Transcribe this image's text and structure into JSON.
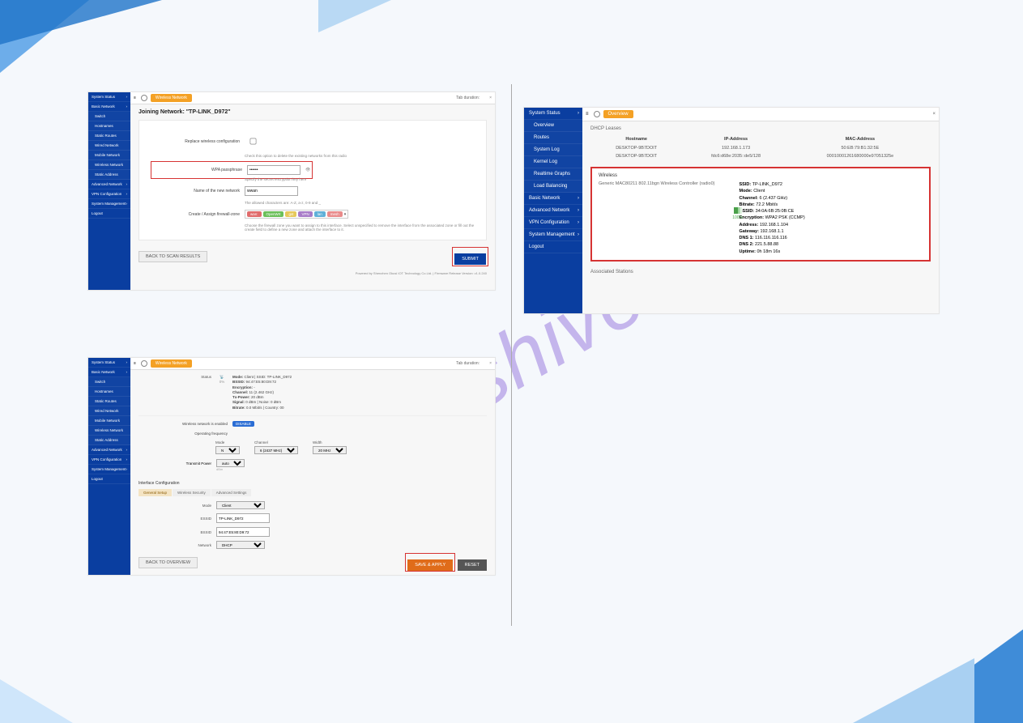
{
  "watermark": "manualshive.com",
  "sidebar": {
    "system_status": "System Status",
    "overview": "Overview",
    "routes": "Routes",
    "system_log": "System Log",
    "kernel_log": "Kernel Log",
    "realtime_graphs": "Realtime Graphs",
    "load_balancing": "Load Balancing",
    "basic_network": "Basic Network",
    "switch": "Switch",
    "hostnames": "Hostnames",
    "static_routes": "Static Routes",
    "wired_network": "Wired Network",
    "mobile_network": "Mobile Network",
    "wireless_network": "Wireless Network",
    "static_address": "Static Address",
    "advanced_network": "Advanced Network",
    "vpn_config": "VPN Configuration",
    "system_management": "System Management",
    "logout": "Logout"
  },
  "tabbar": {
    "active_tab": "Wireless Network",
    "active_tab_overview": "Overview",
    "right_label": "Tab duration:"
  },
  "shot1": {
    "heading": "Joining Network: \"TP-LINK_D972\"",
    "replace_label": "Replace wireless configuration",
    "replace_tip": "Check this option to delete the existing networks from this radio",
    "wpa_label": "WPA passphrase",
    "wpa_tip": "Specify the secret encryption key here",
    "name_label": "Name of the new network",
    "name_value": "wwan",
    "name_tip": "The allowed characters are: A-Z, a-z, 0-9 and _",
    "fw_label": "Create / Assign firewall-zone",
    "fw_tags": {
      "wan": "wan:",
      "OpenWrt": "OpenWrt",
      "gst": "gst",
      "vpn": "VPN",
      "lan": "lan",
      "mesh": "mesh"
    },
    "fw_tip": "Choose the firewall zone you want to assign to this interface. Select unspecified to remove the interface from the associated zone or fill out the create field to define a new zone and attach the interface to it.",
    "back_btn": "BACK TO SCAN RESULTS",
    "submit_btn": "SUBMIT",
    "footnote": "Powered by Shenzhen Okusi IOT Technology Co.Ltd. | Firmware Release Version: v1.0.240"
  },
  "shot2": {
    "status_label": "Status",
    "mode": "Mode: ",
    "mode_val": "Client | SSID: TP-LINK_D972",
    "bssid": "BSSID: ",
    "bssid_val": "94:47:E5:80:D9:72",
    "enc": "Encryption: ",
    "enc_val": "-",
    "channel": "Channel: ",
    "channel_val": "11 (2.462 GHz)",
    "txpower": "Tx-Power: ",
    "txpower_val": "20 dBm",
    "signal": "Signal: ",
    "signal_val": "0 dBm | Noise: 0 dBm",
    "bitrate": "Bitrate: ",
    "bitrate_val": "0.0 Mbit/s | Country: 00",
    "wne_label": "Wireless network is enabled",
    "disable": "DISABLE",
    "opfreq_label": "Operating frequency",
    "mode_col": "Mode",
    "mode_opt": "N",
    "chan_col": "Channel",
    "chan_opt": "6 (2437 MHz)",
    "width_col": "Width",
    "width_opt": "20 MHz",
    "txp_label": "Transmit Power",
    "txp_val": "auto",
    "txp_unit": "dBm",
    "if_conf": "Interface Configuration",
    "tab_gs": "General Setup",
    "tab_ws": "Wireless Security",
    "tab_as": "Advanced Settings",
    "if_mode": "Mode",
    "if_mode_val": "Client",
    "if_essid": "ESSID",
    "if_essid_val": "TP-LINK_D972",
    "if_bssid": "BSSID",
    "if_bssid_val": "94:47:E5:80:D9:72",
    "if_network": "Network",
    "if_network_val": "DHCP",
    "back_btn": "BACK TO OVERVIEW",
    "save_btn": "SAVE & APPLY",
    "reset_btn": "RESET"
  },
  "shot3": {
    "dhcp_title": "DHCP Leases",
    "col_hostname": "Hostname",
    "col_ip": "IP-Address",
    "col_mac": "MAC-Address",
    "row1": {
      "host": "DESKTOP-9B7DOIT",
      "ip": "192.168.1.173",
      "mac": "50:EB:79:B1:32:5E"
    },
    "row2": {
      "host": "DESKTOP-9B7DOIT",
      "ip": "fdc6:d68e:2035::de5/128",
      "mac": "00010001261680000e97051325e"
    },
    "wireless_title": "Wireless",
    "wireless_device": "Generic MAC80211 802.11bgn Wireless Controller (radio0)",
    "signal_pct": "100%",
    "details": {
      "SSID_l": "SSID:",
      "SSID_v": "TP-LINK_D972",
      "Mode_l": "Mode:",
      "Mode_v": "Client",
      "Channel_l": "Channel:",
      "Channel_v": "6 (2.437 GHz)",
      "Bitrate_l": "Bitrate:",
      "Bitrate_v": "72.2 Mbit/s",
      "BSSID_l": "BSSID:",
      "BSSID_v": "34:0A:6B:25:0B:CE",
      "Encryption_l": "Encryption:",
      "Encryption_v": "WPA2 PSK (CCMP)",
      "Address_l": "Address:",
      "Address_v": "192.168.1.104",
      "Gateway_l": "Gateway:",
      "Gateway_v": "192.168.1.1",
      "DNS1_l": "DNS 1:",
      "DNS1_v": "116.116.116.116",
      "DNS2_l": "DNS 2:",
      "DNS2_v": "221.5.88.88",
      "Uptime_l": "Uptime:",
      "Uptime_v": "0h 18m 16s"
    },
    "assoc_title": "Associated Stations"
  }
}
